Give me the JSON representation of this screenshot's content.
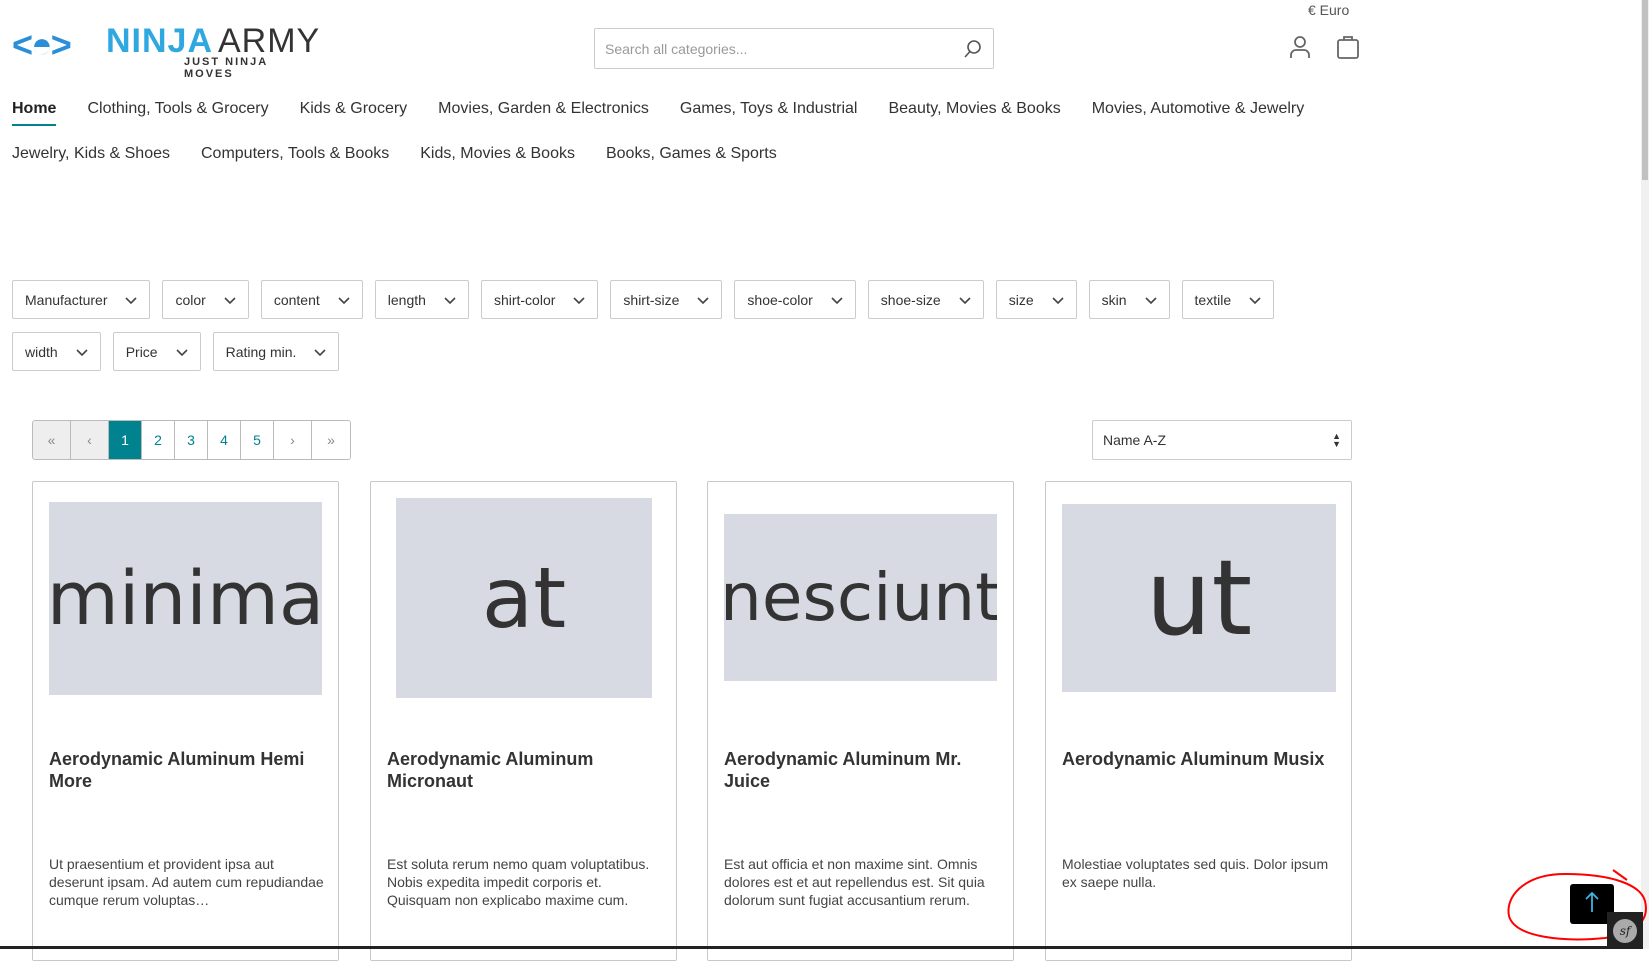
{
  "header": {
    "logo": {
      "word1": "NINJA",
      "word2": "ARMY",
      "tagline": "JUST NINJA MOVES",
      "mark": "<◓>"
    },
    "currency": "€ Euro",
    "search": {
      "placeholder": "Search all categories...",
      "value": ""
    },
    "icons": [
      "user-icon",
      "shopping-bag-icon"
    ]
  },
  "nav": {
    "row1": [
      "Home",
      "Clothing, Tools & Grocery",
      "Kids & Grocery",
      "Movies, Garden & Electronics",
      "Games, Toys & Industrial",
      "Beauty, Movies & Books",
      "Movies, Automotive & Jewelry"
    ],
    "row2": [
      "Jewelry, Kids & Shoes",
      "Computers, Tools & Books",
      "Kids, Movies & Books",
      "Books, Games & Sports"
    ],
    "active": "Home"
  },
  "filters": {
    "row1": [
      "Manufacturer",
      "color",
      "content",
      "length",
      "shirt-color",
      "shirt-size",
      "shoe-color",
      "shoe-size",
      "size",
      "skin",
      "textile"
    ],
    "row2": [
      "width",
      "Price",
      "Rating min."
    ]
  },
  "pagination": {
    "first": "«",
    "prev": "‹",
    "pages": [
      "1",
      "2",
      "3",
      "4",
      "5"
    ],
    "current": "1",
    "next": "›",
    "last": "»"
  },
  "sort": {
    "selected": "Name A-Z"
  },
  "products": [
    {
      "image_text": "minima",
      "title": "Aerodynamic Aluminum Hemi More",
      "description": "Ut praesentium et provident ipsa aut deserunt ipsam. Ad autem cum repudiandae cumque rerum voluptas…"
    },
    {
      "image_text": "at",
      "title": "Aerodynamic Aluminum Micronaut",
      "description": "Est soluta rerum nemo quam voluptatibus. Nobis expedita impedit corporis et. Quisquam non explicabo maxime cum."
    },
    {
      "image_text": "nesciunt",
      "title": "Aerodynamic Aluminum Mr. Juice",
      "description": "Est aut officia et non maxime sint. Omnis dolores est et aut repellendus est. Sit quia dolorum sunt fugiat accusantium rerum."
    },
    {
      "image_text": "ut",
      "title": "Aerodynamic Aluminum Musix",
      "description": "Molestiae voluptates sed quis. Dolor ipsum ex saepe nulla."
    }
  ],
  "colors": {
    "accent": "#00838f",
    "logo_blue": "#2fa8e0",
    "annotation": "#ff0000"
  }
}
